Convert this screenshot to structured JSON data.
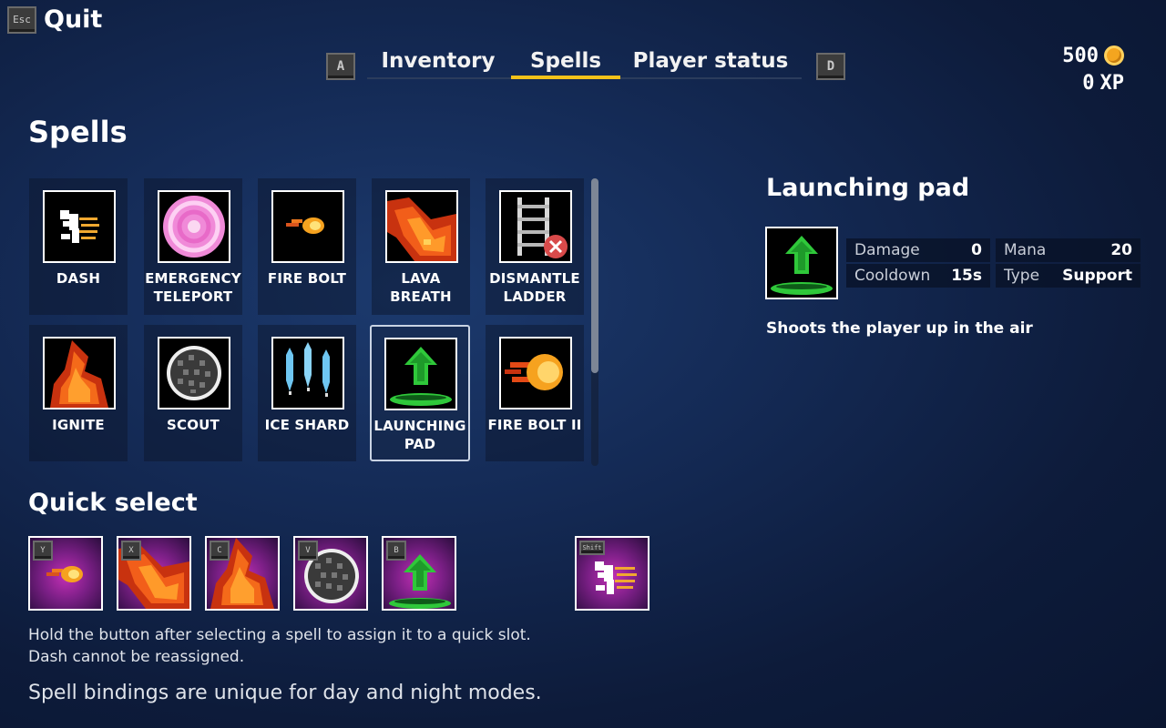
{
  "header": {
    "quit_key": "Esc",
    "quit_label": "Quit",
    "prev_tab_key": "A",
    "next_tab_key": "D",
    "tabs": [
      {
        "label": "Inventory",
        "active": false
      },
      {
        "label": "Spells",
        "active": true
      },
      {
        "label": "Player status",
        "active": false
      }
    ],
    "gold": "500",
    "xp_value": "0",
    "xp_label": "XP",
    "accent_color": "#f3c21a"
  },
  "spells_section": {
    "title": "Spells",
    "spells": [
      {
        "name": "DASH",
        "icon": "dash-icon"
      },
      {
        "name": "EMERGENCY\nTELEPORT",
        "icon": "portal-icon"
      },
      {
        "name": "FIRE BOLT",
        "icon": "fireball-icon"
      },
      {
        "name": "LAVA BREATH",
        "icon": "lava-icon"
      },
      {
        "name": "DISMANTLE\nLADDER",
        "icon": "ladder-remove-icon"
      },
      {
        "name": "IGNITE",
        "icon": "flame-icon"
      },
      {
        "name": "SCOUT",
        "icon": "scout-orb-icon"
      },
      {
        "name": "ICE SHARD",
        "icon": "ice-shard-icon"
      },
      {
        "name": "LAUNCHING\nPAD",
        "icon": "launch-arrow-icon",
        "selected": true
      },
      {
        "name": "FIRE BOLT II",
        "icon": "big-fireball-icon"
      }
    ]
  },
  "detail": {
    "title": "Launching pad",
    "icon": "launch-arrow-icon",
    "stats": [
      {
        "label": "Damage",
        "value": "0"
      },
      {
        "label": "Mana",
        "value": "20"
      },
      {
        "label": "Cooldown",
        "value": "15s"
      },
      {
        "label": "Type",
        "value": "Support"
      }
    ],
    "description": "Shoots the player up in the air"
  },
  "quick_select": {
    "title": "Quick select",
    "slots": [
      {
        "key": "Y",
        "icon": "fireball-icon"
      },
      {
        "key": "X",
        "icon": "lava-icon"
      },
      {
        "key": "C",
        "icon": "flame-icon"
      },
      {
        "key": "V",
        "icon": "scout-orb-icon"
      },
      {
        "key": "B",
        "icon": "launch-arrow-icon"
      },
      {
        "key": "Shift",
        "icon": "dash-icon"
      }
    ],
    "hint_line1": "Hold the button after selecting a spell to assign it to a quick slot.",
    "hint_line2": "Dash cannot be reassigned.",
    "note": "Spell bindings are unique for day and night modes."
  }
}
